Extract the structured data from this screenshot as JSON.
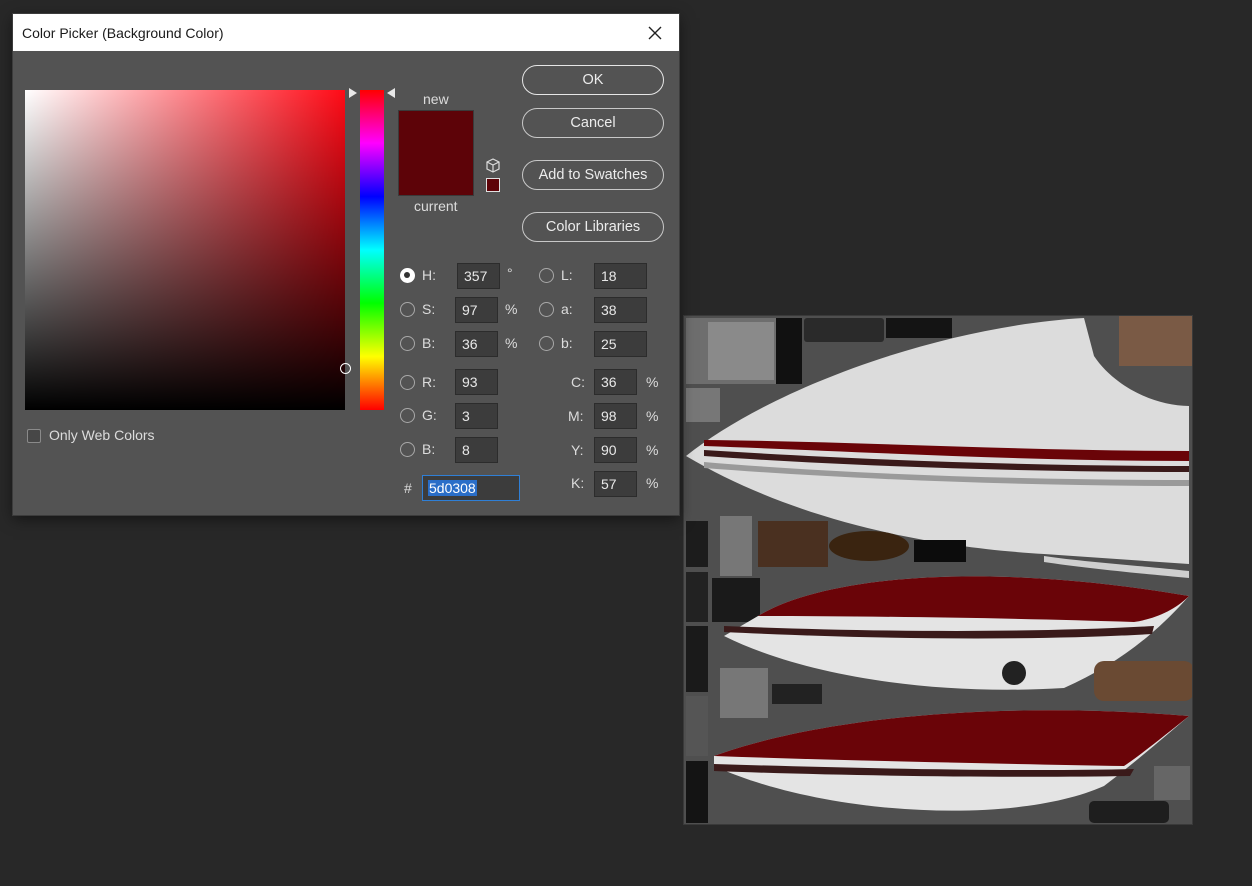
{
  "dialog": {
    "title": "Color Picker (Background Color)",
    "new_label": "new",
    "current_label": "current",
    "color_hex": "#5d0308",
    "buttons": {
      "ok": "OK",
      "cancel": "Cancel",
      "add_to_swatches": "Add to Swatches",
      "color_libraries": "Color Libraries"
    },
    "only_web_colors": "Only Web Colors",
    "hsb": {
      "h_label": "H:",
      "h_value": "357",
      "h_unit": "°",
      "s_label": "S:",
      "s_value": "97",
      "s_unit": "%",
      "b_label": "B:",
      "b_value": "36",
      "b_unit": "%"
    },
    "rgb": {
      "r_label": "R:",
      "r_value": "93",
      "g_label": "G:",
      "g_value": "3",
      "b_label": "B:",
      "b_value": "8"
    },
    "lab": {
      "l_label": "L:",
      "l_value": "18",
      "a_label": "a:",
      "a_value": "38",
      "b_label": "b:",
      "b_value": "25"
    },
    "cmyk": {
      "c_label": "C:",
      "c_value": "36",
      "m_label": "M:",
      "m_value": "98",
      "y_label": "Y:",
      "y_value": "90",
      "k_label": "K:",
      "k_value": "57",
      "unit": "%"
    },
    "hex_label": "#",
    "hex_value": "5d0308"
  },
  "icons": {
    "close": "close-icon",
    "cube": "web-safe-cube-icon"
  }
}
